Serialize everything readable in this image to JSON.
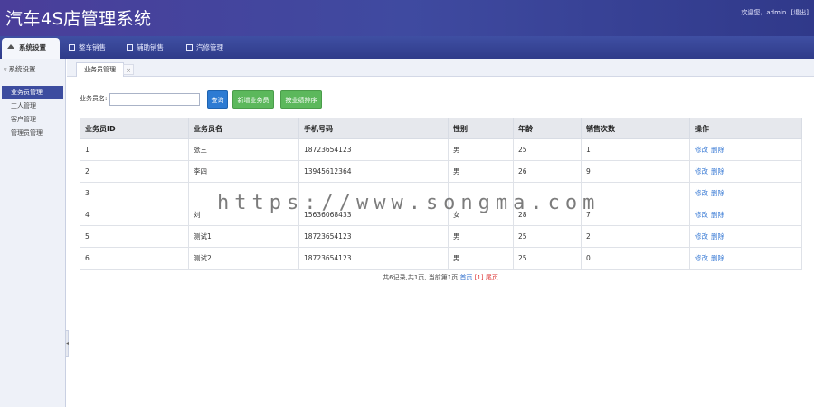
{
  "header": {
    "title": "汽车4S店管理系统",
    "welcome": "欢迎您，admin",
    "logout": "[退出]"
  },
  "nav": {
    "tabs": [
      {
        "label": "系统设置",
        "icon": "home-icon"
      },
      {
        "label": "整车销售",
        "icon": "grid-icon"
      },
      {
        "label": "辅助销售",
        "icon": "grid-icon"
      },
      {
        "label": "汽修管理",
        "icon": "grid-icon"
      }
    ]
  },
  "sidebar": {
    "title": "系统设置",
    "items": [
      {
        "label": "业务员管理"
      },
      {
        "label": "工人管理"
      },
      {
        "label": "客户管理"
      },
      {
        "label": "管理员管理"
      }
    ]
  },
  "content_tab": {
    "label": "业务员管理",
    "close": "×"
  },
  "toolbar": {
    "search_label": "业务员名:",
    "search_value": "",
    "query_label": "查询",
    "add_label": "新增业务员",
    "sort_label": "按业绩排序"
  },
  "table": {
    "headers": [
      "业务员ID",
      "业务员名",
      "手机号码",
      "性别",
      "年龄",
      "销售次数",
      "操作"
    ],
    "rows": [
      {
        "id": "1",
        "name": "张三",
        "phone": "18723654123",
        "gender": "男",
        "age": "25",
        "sales": "1"
      },
      {
        "id": "2",
        "name": "李四",
        "phone": "13945612364",
        "gender": "男",
        "age": "26",
        "sales": "9"
      },
      {
        "id": "3",
        "name": "",
        "phone": "",
        "gender": "",
        "age": "",
        "sales": ""
      },
      {
        "id": "4",
        "name": "刘",
        "phone": "15636068433",
        "gender": "女",
        "age": "28",
        "sales": "7"
      },
      {
        "id": "5",
        "name": "测试1",
        "phone": "18723654123",
        "gender": "男",
        "age": "25",
        "sales": "2"
      },
      {
        "id": "6",
        "name": "测试2",
        "phone": "18723654123",
        "gender": "男",
        "age": "25",
        "sales": "0"
      }
    ],
    "edit_label": "修改",
    "delete_label": "删除"
  },
  "pagination": {
    "summary": "共6记录,共1页, 当前第1页",
    "first": "首页",
    "current": "[1]",
    "last": "尾页"
  },
  "watermark": "https://www.songma.com",
  "colors": {
    "header_bg": "#4a3e9a",
    "nav_bg": "#3f4fa3",
    "query_button": "#2d7bd3",
    "green_button": "#5cb85c",
    "link": "#3a7bd5"
  }
}
